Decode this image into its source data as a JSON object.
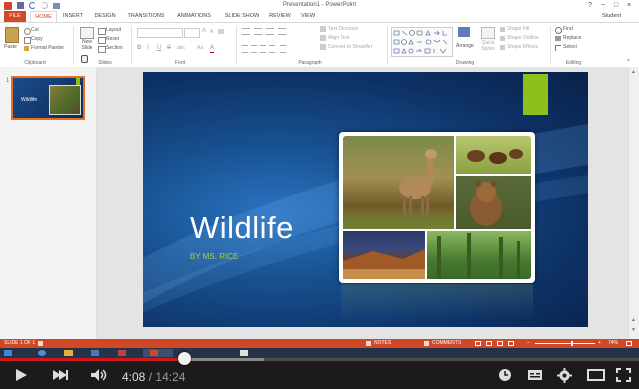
{
  "window": {
    "title": "Presentation1 - PowerPoint",
    "controls": [
      "?",
      "−",
      "□",
      "×"
    ]
  },
  "ribbon": {
    "tabs": [
      "FILE",
      "HOME",
      "INSERT",
      "DESIGN",
      "TRANSITIONS",
      "ANIMATIONS",
      "SLIDE SHOW",
      "REVIEW",
      "VIEW"
    ],
    "active_tab": "HOME",
    "user": "Student",
    "clipboard": {
      "paste": "Paste",
      "cut": "Cut",
      "copy": "Copy",
      "format_painter": "Format Painter",
      "label": "Clipboard"
    },
    "slides": {
      "new_slide": "New Slide",
      "layout": "Layout",
      "reset": "Reset",
      "section": "Section",
      "label": "Slides"
    },
    "font": {
      "label": "Font",
      "bold": "B",
      "italic": "I",
      "underline": "U",
      "strike": "S",
      "shadow": "abc",
      "size_up": "A",
      "size_down": "A",
      "case": "Aa",
      "color": "A"
    },
    "paragraph": {
      "label": "Paragraph",
      "text_direction": "Text Direction",
      "align_text": "Align Text",
      "smartart": "Convert to SmartArt"
    },
    "drawing": {
      "label": "Drawing",
      "arrange": "Arrange",
      "quick_styles": "Quick Styles",
      "shape_fill": "Shape Fill",
      "shape_outline": "Shape Outline",
      "shape_effects": "Shape Effects"
    },
    "editing": {
      "label": "Editing",
      "find": "Find",
      "replace": "Replace",
      "select": "Select"
    }
  },
  "thumbnail": {
    "number": "1",
    "title": "Wildlife"
  },
  "slide": {
    "title": "Wildlife",
    "subtitle_prefix": "BY",
    "subtitle_name": "MS. RICE"
  },
  "statusbar": {
    "slide_info": "SLIDE 1 OF 1",
    "notes": "NOTES",
    "comments": "COMMENTS",
    "zoom": "74%"
  },
  "video": {
    "current_time": "4:08",
    "separator": "/",
    "duration": "14:24",
    "progress": 0.288
  },
  "colors": {
    "accent": "#d24726",
    "slide_green": "#8fbf1c",
    "slide_blue": "#17508f",
    "video_red": "#cc181e"
  }
}
